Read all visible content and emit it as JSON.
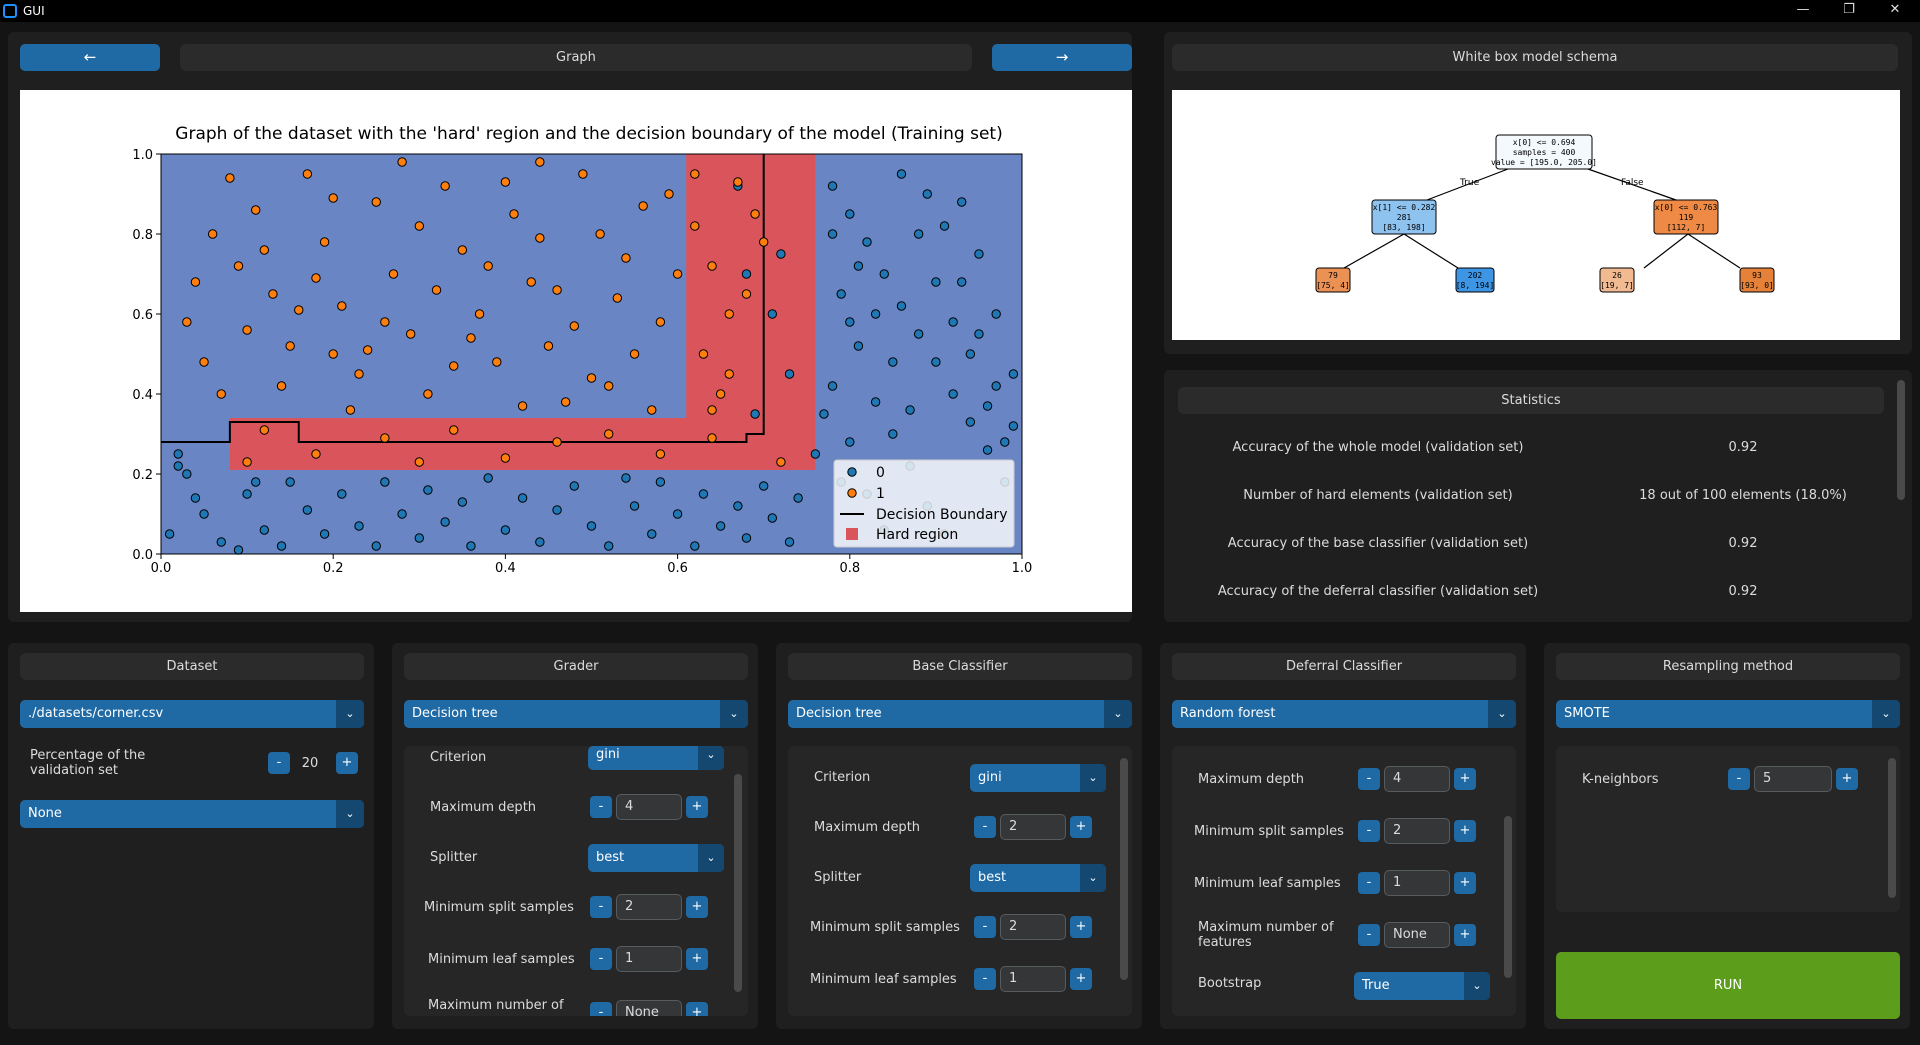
{
  "window": {
    "title": "GUI",
    "minimize": "—",
    "restore": "❐",
    "close": "✕"
  },
  "graph_nav": {
    "prev": "←",
    "title": "Graph",
    "next": "→"
  },
  "schema": {
    "title": "White box model schema",
    "tree": {
      "root": [
        "x[0] <= 0.694",
        "samples = 400",
        "value = [195.0, 205.0]"
      ],
      "true_label": "True",
      "false_label": "False",
      "left": [
        "x[1] <= 0.282",
        "281",
        "[83, 198]"
      ],
      "right": [
        "x[0] <= 0.763",
        "119",
        "[112, 7]"
      ],
      "ll": [
        "79",
        "[75, 4]"
      ],
      "lr": [
        "202",
        "[8, 194]"
      ],
      "rl": [
        "26",
        "[19, 7]"
      ],
      "rr": [
        "93",
        "[93, 0]"
      ]
    }
  },
  "statistics": {
    "title": "Statistics",
    "rows": [
      {
        "label": "Accuracy of the whole model (validation set)",
        "value": "0.92"
      },
      {
        "label": "Number of hard elements (validation set)",
        "value": "18 out of 100 elements (18.0%)"
      },
      {
        "label": "Accuracy of the base classifier (validation set)",
        "value": "0.92"
      },
      {
        "label": "Accuracy of the deferral classifier (validation set)",
        "value": "0.92"
      }
    ]
  },
  "dataset": {
    "title": "Dataset",
    "file": "./datasets/corner.csv",
    "validation_label": "Percentage of the validation set",
    "validation_value": "20",
    "extra": "None"
  },
  "grader": {
    "title": "Grader",
    "model": "Decision tree",
    "criterion_label": "Criterion",
    "criterion": "gini",
    "max_depth_label": "Maximum depth",
    "max_depth": "4",
    "splitter_label": "Splitter",
    "splitter": "best",
    "min_split_label": "Minimum split samples",
    "min_split": "2",
    "min_leaf_label": "Minimum leaf samples",
    "min_leaf": "1",
    "max_features_label": "Maximum number of",
    "max_features": "None"
  },
  "base": {
    "title": "Base Classifier",
    "model": "Decision tree",
    "criterion_label": "Criterion",
    "criterion": "gini",
    "max_depth_label": "Maximum depth",
    "max_depth": "2",
    "splitter_label": "Splitter",
    "splitter": "best",
    "min_split_label": "Minimum split samples",
    "min_split": "2",
    "min_leaf_label": "Minimum leaf samples",
    "min_leaf": "1"
  },
  "deferral": {
    "title": "Deferral Classifier",
    "model": "Random forest",
    "max_depth_label": "Maximum depth",
    "max_depth": "4",
    "min_split_label": "Minimum split samples",
    "min_split": "2",
    "min_leaf_label": "Minimum leaf samples",
    "min_leaf": "1",
    "max_features_label": "Maximum number of features",
    "max_features": "None",
    "bootstrap_label": "Bootstrap",
    "bootstrap": "True"
  },
  "resampling": {
    "title": "Resampling method",
    "method": "SMOTE",
    "k_label": "K-neighbors",
    "k_value": "5"
  },
  "run_label": "RUN",
  "spin": {
    "minus": "-",
    "plus": "+"
  },
  "colors": {
    "accent": "#1f6aa5",
    "run": "#5c9d1c",
    "class0_region": "#6a85c3",
    "hard_region": "#d9555b",
    "class0_point": "#1f77b4",
    "class1_point": "#ff7f0e",
    "tree_blue": "#8ec2ef",
    "tree_orange": "#ee8a45"
  },
  "chart_data": {
    "type": "scatter",
    "title": "Graph of the dataset with the 'hard' region and the decision boundary of the model (Training set)",
    "xlim": [
      0.0,
      1.0
    ],
    "ylim": [
      0.0,
      1.0
    ],
    "xticks": [
      "0.0",
      "0.2",
      "0.4",
      "0.6",
      "0.8",
      "1.0"
    ],
    "yticks": [
      "0.0",
      "0.2",
      "0.4",
      "0.6",
      "0.8",
      "1.0"
    ],
    "legend": {
      "placement": "lower-right",
      "entries": [
        "0",
        "1",
        "Decision Boundary",
        "Hard region"
      ]
    },
    "hard_region": [
      [
        0.08,
        0.21
      ],
      [
        0.76,
        0.21
      ],
      [
        0.76,
        1.0
      ],
      [
        0.61,
        1.0
      ],
      [
        0.61,
        0.34
      ],
      [
        0.08,
        0.34
      ]
    ],
    "decision_boundary": [
      [
        0.0,
        0.28
      ],
      [
        0.08,
        0.28
      ],
      [
        0.08,
        0.33
      ],
      [
        0.16,
        0.33
      ],
      [
        0.16,
        0.28
      ],
      [
        0.68,
        0.28
      ],
      [
        0.68,
        0.3
      ],
      [
        0.7,
        0.3
      ],
      [
        0.7,
        1.0
      ]
    ],
    "series": [
      {
        "name": "0",
        "points": [
          [
            0.02,
            0.22
          ],
          [
            0.03,
            0.2
          ],
          [
            0.05,
            0.1
          ],
          [
            0.07,
            0.03
          ],
          [
            0.1,
            0.15
          ],
          [
            0.12,
            0.06
          ],
          [
            0.14,
            0.02
          ],
          [
            0.15,
            0.18
          ],
          [
            0.17,
            0.11
          ],
          [
            0.19,
            0.05
          ],
          [
            0.21,
            0.15
          ],
          [
            0.23,
            0.07
          ],
          [
            0.25,
            0.02
          ],
          [
            0.26,
            0.18
          ],
          [
            0.28,
            0.1
          ],
          [
            0.3,
            0.04
          ],
          [
            0.31,
            0.16
          ],
          [
            0.33,
            0.08
          ],
          [
            0.35,
            0.13
          ],
          [
            0.36,
            0.02
          ],
          [
            0.38,
            0.19
          ],
          [
            0.4,
            0.06
          ],
          [
            0.42,
            0.14
          ],
          [
            0.44,
            0.03
          ],
          [
            0.46,
            0.11
          ],
          [
            0.48,
            0.17
          ],
          [
            0.5,
            0.07
          ],
          [
            0.52,
            0.02
          ],
          [
            0.54,
            0.19
          ],
          [
            0.55,
            0.12
          ],
          [
            0.57,
            0.05
          ],
          [
            0.58,
            0.18
          ],
          [
            0.6,
            0.1
          ],
          [
            0.62,
            0.02
          ],
          [
            0.63,
            0.15
          ],
          [
            0.65,
            0.07
          ],
          [
            0.67,
            0.12
          ],
          [
            0.68,
            0.04
          ],
          [
            0.7,
            0.17
          ],
          [
            0.71,
            0.09
          ],
          [
            0.73,
            0.03
          ],
          [
            0.74,
            0.14
          ],
          [
            0.01,
            0.05
          ],
          [
            0.04,
            0.14
          ],
          [
            0.09,
            0.01
          ],
          [
            0.11,
            0.18
          ],
          [
            0.78,
            0.92
          ],
          [
            0.8,
            0.85
          ],
          [
            0.82,
            0.78
          ],
          [
            0.84,
            0.7
          ],
          [
            0.86,
            0.62
          ],
          [
            0.88,
            0.55
          ],
          [
            0.9,
            0.48
          ],
          [
            0.92,
            0.4
          ],
          [
            0.94,
            0.33
          ],
          [
            0.96,
            0.26
          ],
          [
            0.98,
            0.18
          ],
          [
            0.79,
            0.65
          ],
          [
            0.81,
            0.52
          ],
          [
            0.83,
            0.38
          ],
          [
            0.85,
            0.3
          ],
          [
            0.87,
            0.22
          ],
          [
            0.89,
            0.12
          ],
          [
            0.91,
            0.05
          ],
          [
            0.93,
            0.88
          ],
          [
            0.95,
            0.75
          ],
          [
            0.97,
            0.6
          ],
          [
            0.99,
            0.45
          ],
          [
            0.78,
            0.42
          ],
          [
            0.8,
            0.28
          ],
          [
            0.82,
            0.15
          ],
          [
            0.84,
            0.06
          ],
          [
            0.86,
            0.95
          ],
          [
            0.88,
            0.8
          ],
          [
            0.9,
            0.68
          ],
          [
            0.92,
            0.58
          ],
          [
            0.94,
            0.5
          ],
          [
            0.96,
            0.37
          ],
          [
            0.98,
            0.28
          ],
          [
            0.79,
            0.18
          ],
          [
            0.81,
            0.72
          ],
          [
            0.83,
            0.6
          ],
          [
            0.85,
            0.48
          ],
          [
            0.87,
            0.36
          ],
          [
            0.89,
            0.9
          ],
          [
            0.91,
            0.82
          ],
          [
            0.93,
            0.68
          ],
          [
            0.95,
            0.55
          ],
          [
            0.97,
            0.42
          ],
          [
            0.99,
            0.32
          ],
          [
            0.78,
            0.8
          ],
          [
            0.8,
            0.58
          ],
          [
            0.77,
            0.35
          ],
          [
            0.76,
            0.25
          ],
          [
            0.72,
            0.75
          ],
          [
            0.71,
            0.6
          ],
          [
            0.73,
            0.45
          ],
          [
            0.69,
            0.35
          ],
          [
            0.67,
            0.92
          ],
          [
            0.68,
            0.7
          ],
          [
            0.02,
            0.25
          ]
        ]
      },
      {
        "name": "1",
        "points": [
          [
            0.03,
            0.58
          ],
          [
            0.05,
            0.48
          ],
          [
            0.07,
            0.4
          ],
          [
            0.09,
            0.72
          ],
          [
            0.11,
            0.86
          ],
          [
            0.13,
            0.65
          ],
          [
            0.15,
            0.52
          ],
          [
            0.17,
            0.95
          ],
          [
            0.19,
            0.78
          ],
          [
            0.21,
            0.62
          ],
          [
            0.23,
            0.45
          ],
          [
            0.25,
            0.88
          ],
          [
            0.27,
            0.7
          ],
          [
            0.29,
            0.55
          ],
          [
            0.31,
            0.4
          ],
          [
            0.33,
            0.92
          ],
          [
            0.35,
            0.76
          ],
          [
            0.37,
            0.6
          ],
          [
            0.39,
            0.48
          ],
          [
            0.41,
            0.85
          ],
          [
            0.43,
            0.68
          ],
          [
            0.45,
            0.52
          ],
          [
            0.47,
            0.38
          ],
          [
            0.49,
            0.95
          ],
          [
            0.51,
            0.8
          ],
          [
            0.53,
            0.64
          ],
          [
            0.55,
            0.5
          ],
          [
            0.57,
            0.36
          ],
          [
            0.59,
            0.9
          ],
          [
            0.06,
            0.8
          ],
          [
            0.1,
            0.56
          ],
          [
            0.14,
            0.42
          ],
          [
            0.18,
            0.69
          ],
          [
            0.22,
            0.36
          ],
          [
            0.26,
            0.58
          ],
          [
            0.3,
            0.82
          ],
          [
            0.34,
            0.47
          ],
          [
            0.38,
            0.72
          ],
          [
            0.42,
            0.37
          ],
          [
            0.46,
            0.66
          ],
          [
            0.5,
            0.44
          ],
          [
            0.54,
            0.74
          ],
          [
            0.58,
            0.58
          ],
          [
            0.08,
            0.94
          ],
          [
            0.12,
            0.76
          ],
          [
            0.16,
            0.61
          ],
          [
            0.2,
            0.89
          ],
          [
            0.24,
            0.51
          ],
          [
            0.28,
            0.98
          ],
          [
            0.32,
            0.66
          ],
          [
            0.36,
            0.54
          ],
          [
            0.4,
            0.93
          ],
          [
            0.44,
            0.79
          ],
          [
            0.48,
            0.57
          ],
          [
            0.52,
            0.42
          ],
          [
            0.56,
            0.87
          ],
          [
            0.6,
            0.7
          ],
          [
            0.04,
            0.68
          ],
          [
            0.2,
            0.5
          ],
          [
            0.44,
            0.98
          ],
          [
            0.62,
            0.82
          ],
          [
            0.64,
            0.72
          ],
          [
            0.66,
            0.6
          ],
          [
            0.63,
            0.5
          ],
          [
            0.65,
            0.4
          ],
          [
            0.67,
            0.93
          ],
          [
            0.69,
            0.85
          ],
          [
            0.68,
            0.65
          ],
          [
            0.7,
            0.78
          ],
          [
            0.62,
            0.95
          ],
          [
            0.66,
            0.45
          ],
          [
            0.64,
            0.36
          ],
          [
            0.12,
            0.31
          ],
          [
            0.18,
            0.25
          ],
          [
            0.26,
            0.29
          ],
          [
            0.34,
            0.31
          ],
          [
            0.4,
            0.24
          ],
          [
            0.46,
            0.28
          ],
          [
            0.52,
            0.3
          ],
          [
            0.58,
            0.25
          ],
          [
            0.64,
            0.29
          ],
          [
            0.72,
            0.23
          ],
          [
            0.1,
            0.23
          ],
          [
            0.3,
            0.23
          ]
        ]
      }
    ]
  }
}
